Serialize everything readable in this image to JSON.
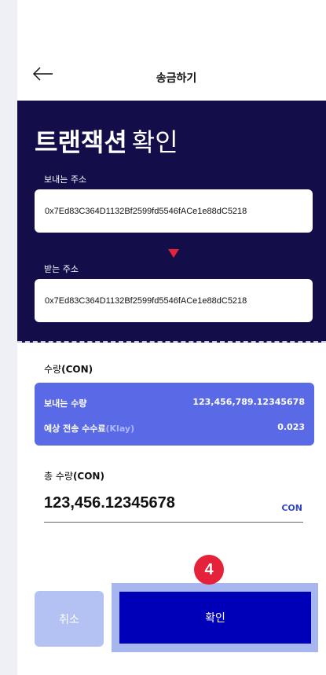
{
  "header": {
    "title": "송금하기",
    "back_icon": "arrow-left-icon"
  },
  "confirm": {
    "title_bold": "트랜잭션",
    "title_light": "확인"
  },
  "sender": {
    "label": "보내는 주소",
    "address": "0x7Ed83C364D1132Bf2599fd5546fACe1e88dC5218"
  },
  "receiver": {
    "label": "받는 주소",
    "address": "0x7Ed83C364D1132Bf2599fd5546fACe1e88dC5218"
  },
  "amount": {
    "label": "수량",
    "unit_label": "(CON)",
    "send_label": "보내는 수량",
    "send_value": "123,456,789.12345678",
    "fee_label": "예상 전송 수수료",
    "fee_unit": "(Klay)",
    "fee_value": "0.023"
  },
  "total": {
    "label": "총 수량",
    "unit_label": "(CON)",
    "value": "123,456.12345678",
    "unit": "CON"
  },
  "buttons": {
    "cancel": "취소",
    "confirm": "확인"
  },
  "step_badge": "4",
  "colors": {
    "dark_bg": "#130e4a",
    "blue_box": "#5a6ae6",
    "primary": "#0000b8",
    "cancel": "#b4c2f3",
    "badge": "#e5223a",
    "arrow": "#e5223a"
  }
}
